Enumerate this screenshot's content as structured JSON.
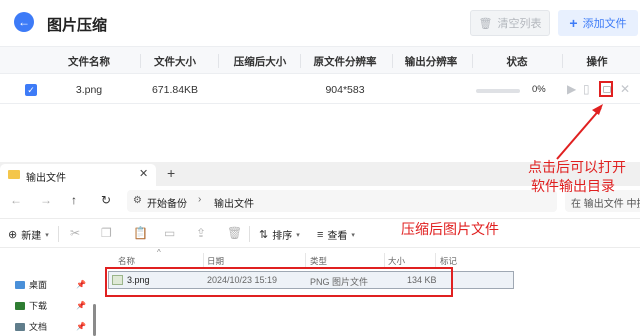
{
  "app": {
    "title": "图片压缩",
    "back_icon": "arrow-left-icon",
    "clear_label": "清空列表",
    "add_label": "添加文件",
    "accent_color": "#3d7bf7"
  },
  "table": {
    "headers": [
      "文件名称",
      "文件大小",
      "压缩后大小",
      "原文件分辨率",
      "输出分辨率",
      "状态",
      "操作"
    ],
    "rows": [
      {
        "name": "3.png",
        "size": "671.84KB",
        "compressed_size": "",
        "resolution": "904*583",
        "output_resolution": "",
        "progress_label": "0%",
        "progress": 0
      }
    ]
  },
  "annotations": {
    "folder_note_line1": "点击后可以打开",
    "folder_note_line2": "软件输出目录",
    "file_note": "压缩后图片文件",
    "color": "#e02020"
  },
  "explorer": {
    "tab_title": "输出文件",
    "new_tab": "+",
    "close_tab": "✕",
    "path": [
      "开始备份",
      "输出文件"
    ],
    "search_placeholder": "在 输出文件 中搜",
    "commands": {
      "new": "新建",
      "sort": "排序",
      "view": "查看"
    },
    "columns": [
      "名称",
      "日期",
      "类型",
      "大小",
      "标记"
    ],
    "sidebar": [
      {
        "label": "桌面"
      },
      {
        "label": "下载"
      },
      {
        "label": "文档"
      }
    ],
    "files": [
      {
        "name": "3.png",
        "date": "2024/10/23 15:19",
        "type": "PNG 图片文件",
        "size": "134 KB"
      }
    ]
  }
}
